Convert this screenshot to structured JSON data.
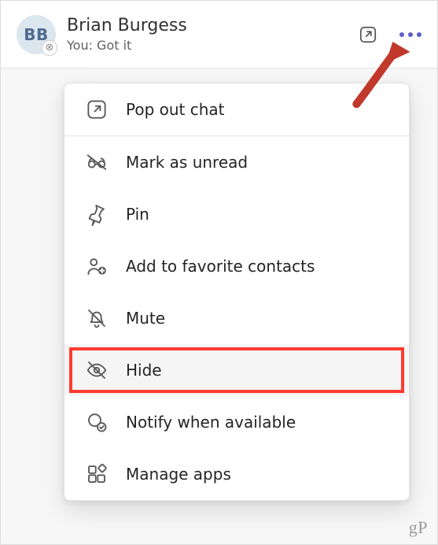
{
  "chat": {
    "initials": "BB",
    "name": "Brian Burgess",
    "preview": "You: Got it",
    "presence_glyph": "⊗"
  },
  "menu": {
    "popout": "Pop out chat",
    "unread": "Mark as unread",
    "pin": "Pin",
    "favorite": "Add to favorite contacts",
    "mute": "Mute",
    "hide": "Hide",
    "notify": "Notify when available",
    "apps": "Manage apps"
  },
  "watermark": "gP"
}
